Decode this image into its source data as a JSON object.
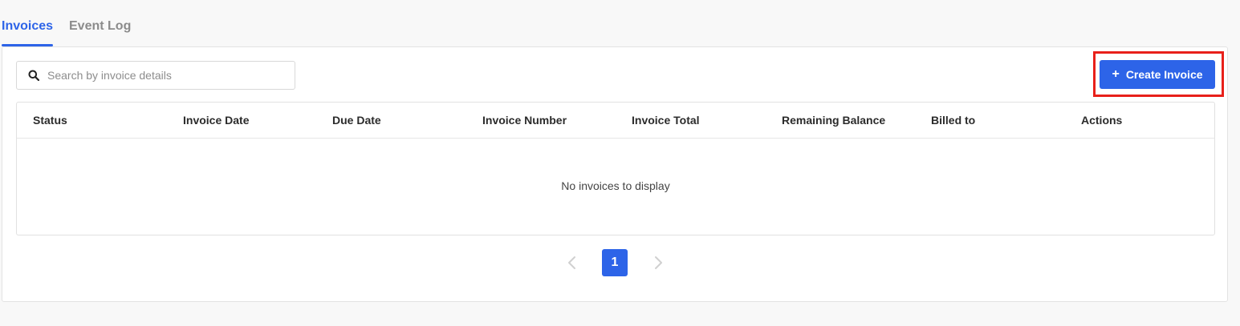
{
  "tabs": [
    {
      "label": "Invoices",
      "active": true
    },
    {
      "label": "Event Log",
      "active": false
    }
  ],
  "search": {
    "placeholder": "Search by invoice details",
    "value": ""
  },
  "toolbar": {
    "create_label": "Create Invoice",
    "create_icon": "plus-icon"
  },
  "table": {
    "columns": [
      "Status",
      "Invoice Date",
      "Due Date",
      "Invoice Number",
      "Invoice Total",
      "Remaining Balance",
      "Billed to",
      "Actions"
    ],
    "rows": [],
    "empty_message": "No invoices to display"
  },
  "pagination": {
    "current_page": "1",
    "prev_icon": "chevron-left-icon",
    "next_icon": "chevron-right-icon"
  },
  "colors": {
    "accent": "#2d64e8",
    "highlight": "#e8201a"
  }
}
